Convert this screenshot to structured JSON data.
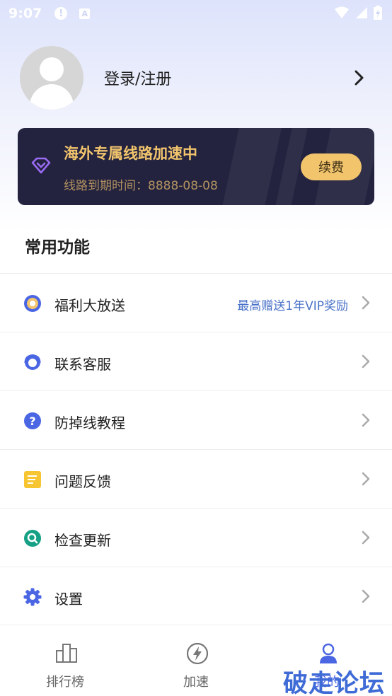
{
  "status_bar": {
    "time": "9:07",
    "alert_glyph": "!",
    "a_glyph": "A"
  },
  "profile": {
    "login_label": "登录/注册"
  },
  "vip": {
    "title": "海外专属线路加速中",
    "expiry": "线路到期时间：8888-08-08",
    "renew_label": "续费"
  },
  "section_title": "常用功能",
  "menu": [
    {
      "label": "福利大放送",
      "extra": "最高赠送1年VIP奖励",
      "icon": "gift-medal-icon"
    },
    {
      "label": "联系客服",
      "extra": "",
      "icon": "customer-service-icon"
    },
    {
      "label": "防掉线教程",
      "extra": "",
      "icon": "help-question-icon"
    },
    {
      "label": "问题反馈",
      "extra": "",
      "icon": "feedback-note-icon"
    },
    {
      "label": "检查更新",
      "extra": "",
      "icon": "update-search-icon"
    },
    {
      "label": "设置",
      "extra": "",
      "icon": "settings-gear-icon"
    }
  ],
  "tabs": [
    {
      "label": "排行榜",
      "icon": "ranking-icon"
    },
    {
      "label": "加速",
      "icon": "lightning-icon"
    },
    {
      "label": "我的",
      "icon": "user-icon"
    }
  ],
  "watermark": "破走论坛",
  "colors": {
    "accent": "#4b66e3",
    "gold": "#f2c56d",
    "card_bg": "#24233f",
    "link": "#4a72c8"
  }
}
